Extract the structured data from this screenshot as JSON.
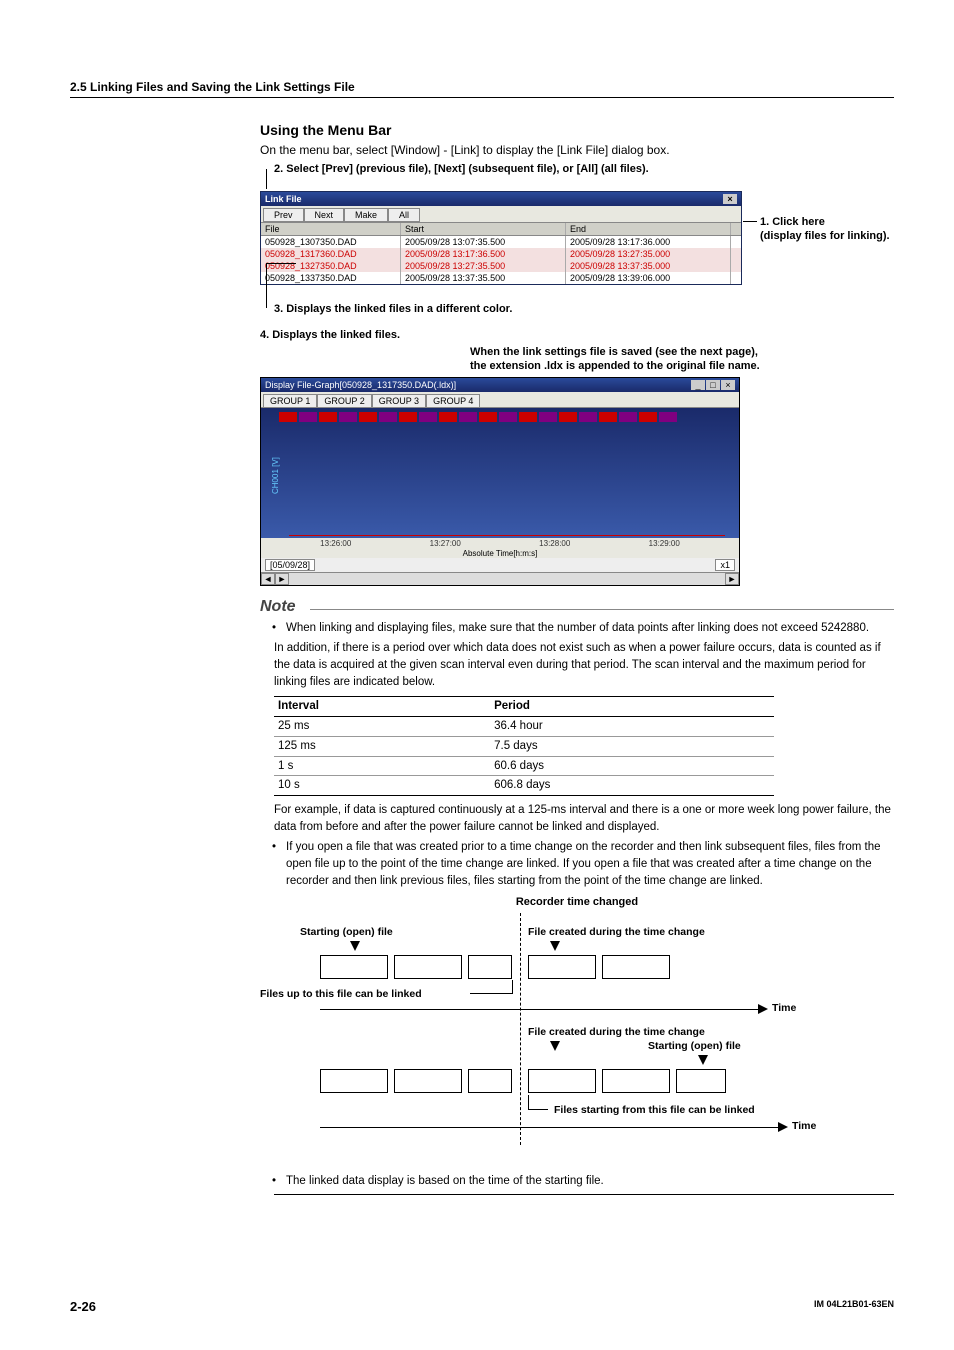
{
  "section_heading": "2.5  Linking Files and Saving the Link Settings File",
  "menu": {
    "heading": "Using the Menu Bar",
    "intro": "On the menu bar, select [Window] - [Link] to display the [Link File] dialog box.",
    "cap_top": "2. Select [Prev] (previous file), [Next] (subsequent file), or [All] (all files).",
    "right1": "1. Click here",
    "right2": "(display files for linking).",
    "cap3": "3. Displays the linked files in a different color.",
    "cap4": "4. Displays the linked files.",
    "cap5a": "When the link settings file is saved (see the next page),",
    "cap5b": "the extension .ldx is appended to the original file name."
  },
  "dialog": {
    "title": "Link File",
    "btn_prev": "Prev",
    "btn_next": "Next",
    "btn_make": "Make",
    "btn_all": "All",
    "col_file": "File",
    "col_start": "Start",
    "col_end": "End",
    "rows": [
      {
        "f": "050928_1307350.DAD",
        "s": "2005/09/28 13:07:35.500",
        "e": "2005/09/28 13:17:36.000",
        "red": false
      },
      {
        "f": "050928_1317360.DAD",
        "s": "2005/09/28 13:17:36.500",
        "e": "2005/09/28 13:27:35.000",
        "red": true
      },
      {
        "f": "050928_1327350.DAD",
        "s": "2005/09/28 13:27:35.500",
        "e": "2005/09/28 13:37:35.000",
        "red": true
      },
      {
        "f": "050928_1337350.DAD",
        "s": "2005/09/28 13:37:35.500",
        "e": "2005/09/28 13:39:06.000",
        "red": false
      }
    ]
  },
  "graph": {
    "title": "Display File-Graph[050928_1317350.DAD(.ldx)]",
    "tabs": [
      "GROUP 1",
      "GROUP 2",
      "GROUP 3",
      "GROUP 4"
    ],
    "axis": [
      "13:26:00",
      "13:27:00",
      "13:28:00",
      "13:29:00"
    ],
    "axis_label": "Absolute Time[h:m:s]",
    "date": "[05/09/28]",
    "zoom": "x1"
  },
  "note": {
    "heading": "Note",
    "bullet1a": "When linking and displaying files, make sure that the number of data points after linking does not exceed 5242880.",
    "p1": "In addition, if there is a period over which data does not exist such as when a power failure occurs, data is counted as if the data is acquired at the given scan interval even during that period. The scan interval and the maximum period for linking files are indicated below.",
    "table": {
      "h1": "Interval",
      "h2": "Period",
      "rows": [
        {
          "i": "25 ms",
          "p": "36.4 hour"
        },
        {
          "i": "125 ms",
          "p": "7.5 days"
        },
        {
          "i": "1 s",
          "p": "60.6 days"
        },
        {
          "i": "10 s",
          "p": "606.8 days"
        }
      ]
    },
    "p2": "For example, if data is captured continuously at a 125-ms interval and there is a one or more week long power failure, the data from before and after the power failure cannot be linked and displayed.",
    "bullet2": "If you open a file that was created prior to a time change on the recorder and then link subsequent files, files from the open file up to the point of the time change are linked. If you open a file that was created after a time change on the recorder and then link previous files, files starting from the point of the time change are linked.",
    "bullet3": "The linked data display is based on the time of the starting file."
  },
  "diagram": {
    "title": "Recorder time changed",
    "starting": "Starting (open) file",
    "created_during": "File created during the time change",
    "up_to": "Files up to this file can be linked",
    "time": "Time",
    "starting2": "Starting (open) file",
    "created_during2": "File created during the time change",
    "from_this": "Files starting from this file can be linked"
  },
  "footer": {
    "page": "2-26",
    "doc": "IM 04L21B01-63EN"
  }
}
